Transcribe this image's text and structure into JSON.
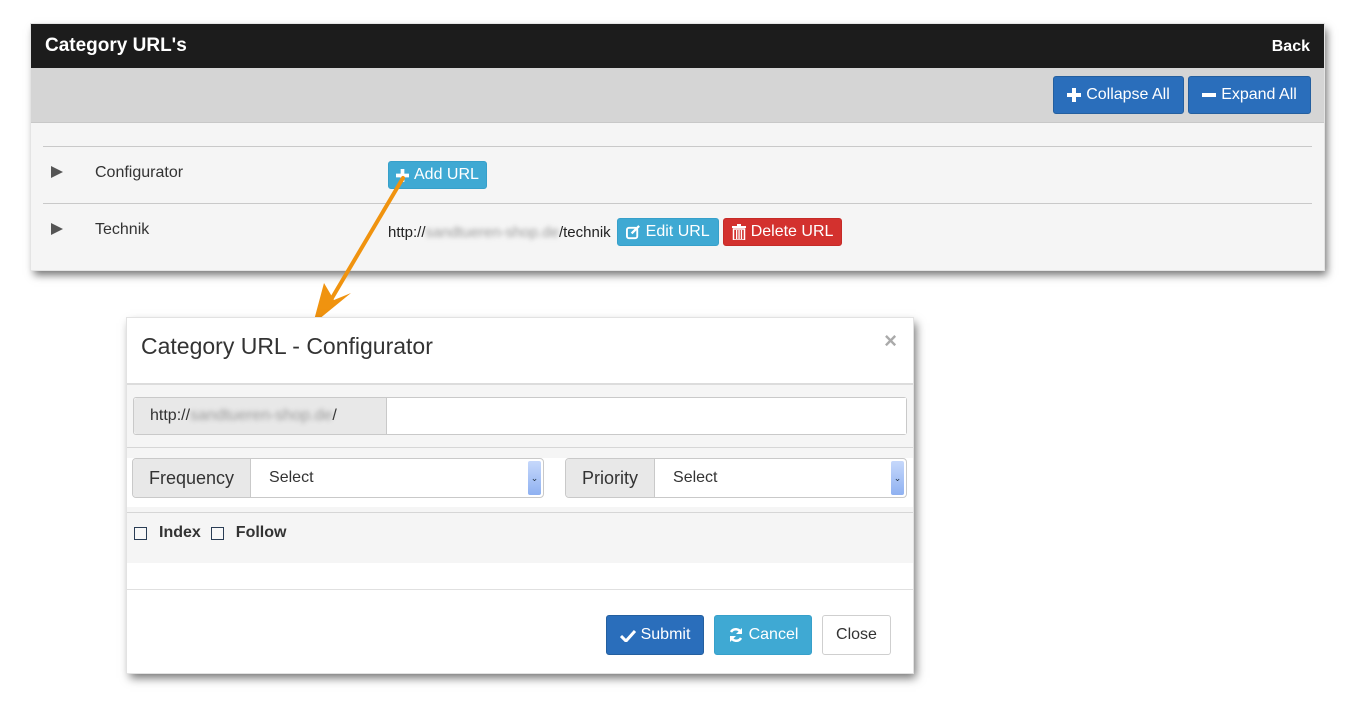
{
  "panel": {
    "title": "Category URL's",
    "back_label": "Back",
    "toolbar": {
      "collapse_all_label": "Collapse All",
      "expand_all_label": "Expand All"
    },
    "rows": [
      {
        "name": "Configurator",
        "add_url_label": "Add URL"
      },
      {
        "name": "Technik",
        "url_prefix": "http://",
        "url_domain_blurred": "sandtueren-shop.de",
        "url_path": "/technik",
        "edit_label": "Edit URL",
        "delete_label": "Delete URL"
      }
    ]
  },
  "annotation": {
    "arrow_color": "#f0930f"
  },
  "modal": {
    "title": "Category URL - Configurator",
    "close_symbol": "×",
    "url_addon_prefix": "http://",
    "url_addon_domain_blurred": "sandtueren-shop.de",
    "url_addon_suffix": "/",
    "url_value": "",
    "frequency_label": "Frequency",
    "frequency_selected": "Select",
    "priority_label": "Priority",
    "priority_selected": "Select",
    "index_label": "Index",
    "follow_label": "Follow",
    "submit_label": "Submit",
    "cancel_label": "Cancel",
    "close_label": "Close"
  }
}
